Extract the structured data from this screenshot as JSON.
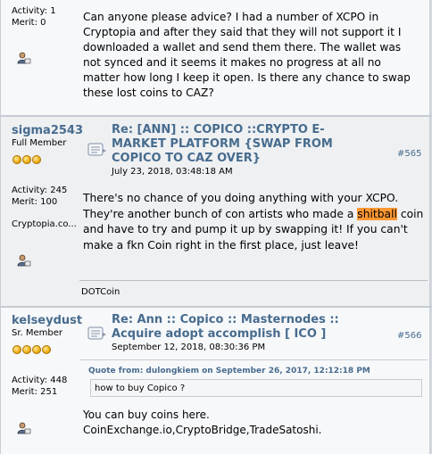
{
  "posts": [
    {
      "stats": {
        "activity": "Activity: 1",
        "merit": "Merit: 0"
      },
      "body": "Can anyone please advice? I had a number of XCPO in Cryptopia and after they said that they will not support it I downloaded a wallet and send them there. The wallet was not synced and it seems it makes no progress at all no matter how long I keep it open. Is there any chance to swap these lost coins to CAZ?"
    },
    {
      "username": "sigma2543",
      "rank": "Full Member",
      "stars": 3,
      "stats": {
        "activity": "Activity: 245",
        "merit": "Merit: 100"
      },
      "website": "Cryptopia.co...",
      "subject": "Re: [ANN] :: COPICO ::CRYPTO E-MARKET PLATFORM {SWAP FROM COPICO TO CAZ OVER}",
      "date": "July 23, 2018, 03:48:18 AM",
      "postnum": "#565",
      "body_before": "There's no chance of you doing anything with your XCPO. They're another bunch of con artists who made a ",
      "body_highlight": "shitball",
      "body_after": " coin and have to try and pump it up by swapping it! If you can't make a fkn Coin right in the first place, just leave!",
      "signature": "DOTCoin"
    },
    {
      "username": "kelseydust",
      "rank": "Sr. Member",
      "stars": 4,
      "stats": {
        "activity": "Activity: 448",
        "merit": "Merit: 251"
      },
      "subject": "Re: Ann :: Copico :: Masternodes :: Acquire adopt accomplish [ ICO ]",
      "date": "September 12, 2018, 08:30:36 PM",
      "postnum": "#566",
      "quote_header": "Quote from: dulongkiem on September 26, 2017, 12:12:18 PM",
      "quote_text": "how to buy Copico ?",
      "body_line1": "You can buy coins here.",
      "body_line2": "CoinExchange.io,CryptoBridge,TradeSatoshi."
    }
  ]
}
